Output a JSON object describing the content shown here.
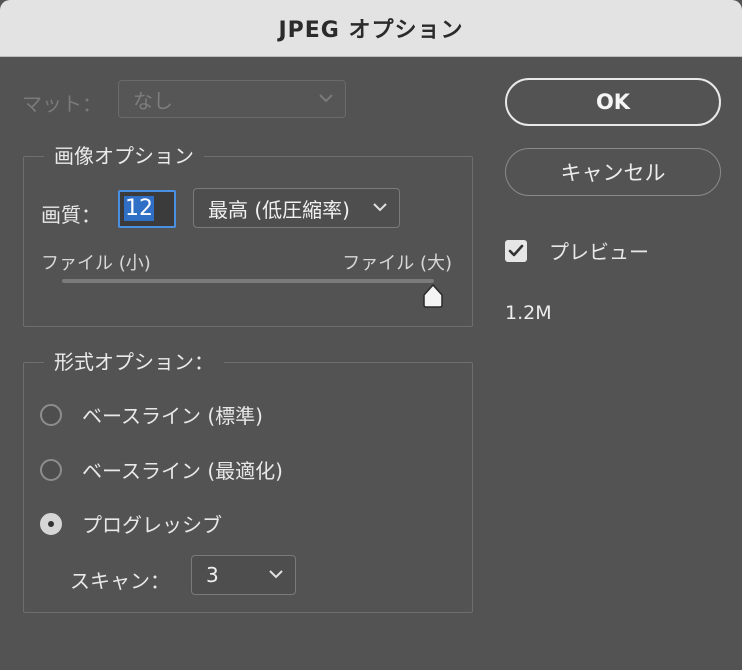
{
  "window": {
    "title": "JPEG オプション"
  },
  "matte": {
    "label": "マット：",
    "value": "なし"
  },
  "image_options": {
    "legend": "画像オプション",
    "quality_label": "画質：",
    "quality_value": "12",
    "quality_preset": "最高 (低圧縮率)",
    "small_file_label": "ファイル (小)",
    "large_file_label": "ファイル (大)",
    "slider_fraction": 1.0
  },
  "format_options": {
    "legend": "形式オプション：",
    "radios": [
      {
        "label": "ベースライン (標準)",
        "checked": false
      },
      {
        "label": "ベースライン (最適化)",
        "checked": false
      },
      {
        "label": "プログレッシブ",
        "checked": true
      }
    ],
    "scan_label": "スキャン：",
    "scan_value": "3"
  },
  "buttons": {
    "ok": "OK",
    "cancel": "キャンセル"
  },
  "preview": {
    "label": "プレビュー",
    "checked": true
  },
  "file_size": "1.2M",
  "colors": {
    "accent": "#4a90e2",
    "background": "#535353",
    "titlebar": "#e3e3e3"
  },
  "icons": {
    "select_arrow": "chevron-down-icon",
    "check": "checkmark-icon",
    "slider": "slider-thumb-icon"
  }
}
